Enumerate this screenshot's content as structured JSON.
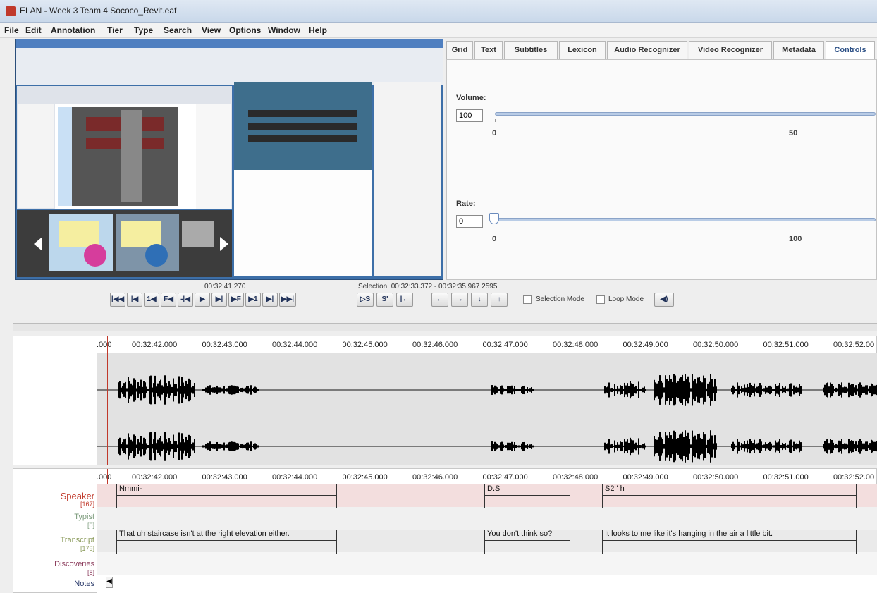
{
  "window": {
    "title": "ELAN - Week 3 Team 4 Sococo_Revit.eaf"
  },
  "menu": [
    "File",
    "Edit",
    "Annotation",
    "Tier",
    "Type",
    "Search",
    "View",
    "Options",
    "Window",
    "Help"
  ],
  "tabs": [
    "Grid",
    "Text",
    "Subtitles",
    "Lexicon",
    "Audio Recognizer",
    "Video Recognizer",
    "Metadata",
    "Controls"
  ],
  "active_tab": "Controls",
  "controls": {
    "volume_label": "Volume:",
    "volume_value": "100",
    "volume_ticks": [
      "0",
      "50"
    ],
    "rate_label": "Rate:",
    "rate_value": "0",
    "rate_ticks": [
      "0",
      "100"
    ]
  },
  "media": {
    "current_time": "00:32:41.270",
    "selection": "Selection: 00:32:33.372 - 00:32:35.967  2595",
    "selection_mode": "Selection Mode",
    "loop_mode": "Loop Mode"
  },
  "ruler": {
    "start": ".000",
    "times": [
      "00:32:42.000",
      "00:32:43.000",
      "00:32:44.000",
      "00:32:45.000",
      "00:32:46.000",
      "00:32:47.000",
      "00:32:48.000",
      "00:32:49.000",
      "00:32:50.000",
      "00:32:51.000",
      "00:32:52.00"
    ]
  },
  "tiers": [
    {
      "name": "Speaker",
      "count": "[167]",
      "color": "#c0392b"
    },
    {
      "name": "Typist",
      "count": "[0]",
      "color": "#7a9a7a"
    },
    {
      "name": "Transcript",
      "count": "[179]",
      "color": "#8a9a5a"
    },
    {
      "name": "Discoveries",
      "count": "[8]",
      "color": "#8a3a5a"
    },
    {
      "name": "Notes",
      "count": "",
      "color": "#2a3a6a"
    }
  ],
  "annotations": {
    "speaker": [
      "Nmmi-",
      "D.S",
      "S2 ' h"
    ],
    "transcript": [
      "That uh staircase isn't at the right elevation either.",
      "You don't think so?",
      "It looks to me like it's hanging in the air a little bit."
    ]
  }
}
